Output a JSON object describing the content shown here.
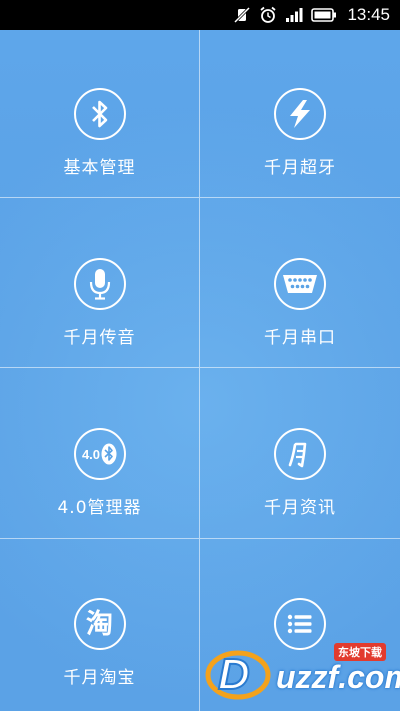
{
  "status_bar": {
    "time": "13:45",
    "icons": [
      "mute-vibrate-icon",
      "alarm-icon",
      "signal-icon",
      "battery-icon"
    ]
  },
  "tiles": [
    {
      "label": "基本管理",
      "icon": "bluetooth-icon"
    },
    {
      "label": "千月超牙",
      "icon": "lightning-icon"
    },
    {
      "label": "千月传音",
      "icon": "microphone-icon"
    },
    {
      "label": "千月串口",
      "icon": "serial-port-icon"
    },
    {
      "label": "4.0管理器",
      "icon": "bluetooth-4-icon",
      "badge": "4.0"
    },
    {
      "label": "千月资讯",
      "icon": "qianyue-logo-icon"
    },
    {
      "label": "千月淘宝",
      "icon": "taobao-icon",
      "badge": "淘"
    },
    {
      "label": "",
      "icon": "list-menu-icon"
    }
  ],
  "watermark": {
    "text": "uzzf.com",
    "tag": "东坡下载"
  },
  "colors": {
    "background": "#5aa3e6",
    "divider": "#ffffff",
    "status_bar": "#000000"
  }
}
